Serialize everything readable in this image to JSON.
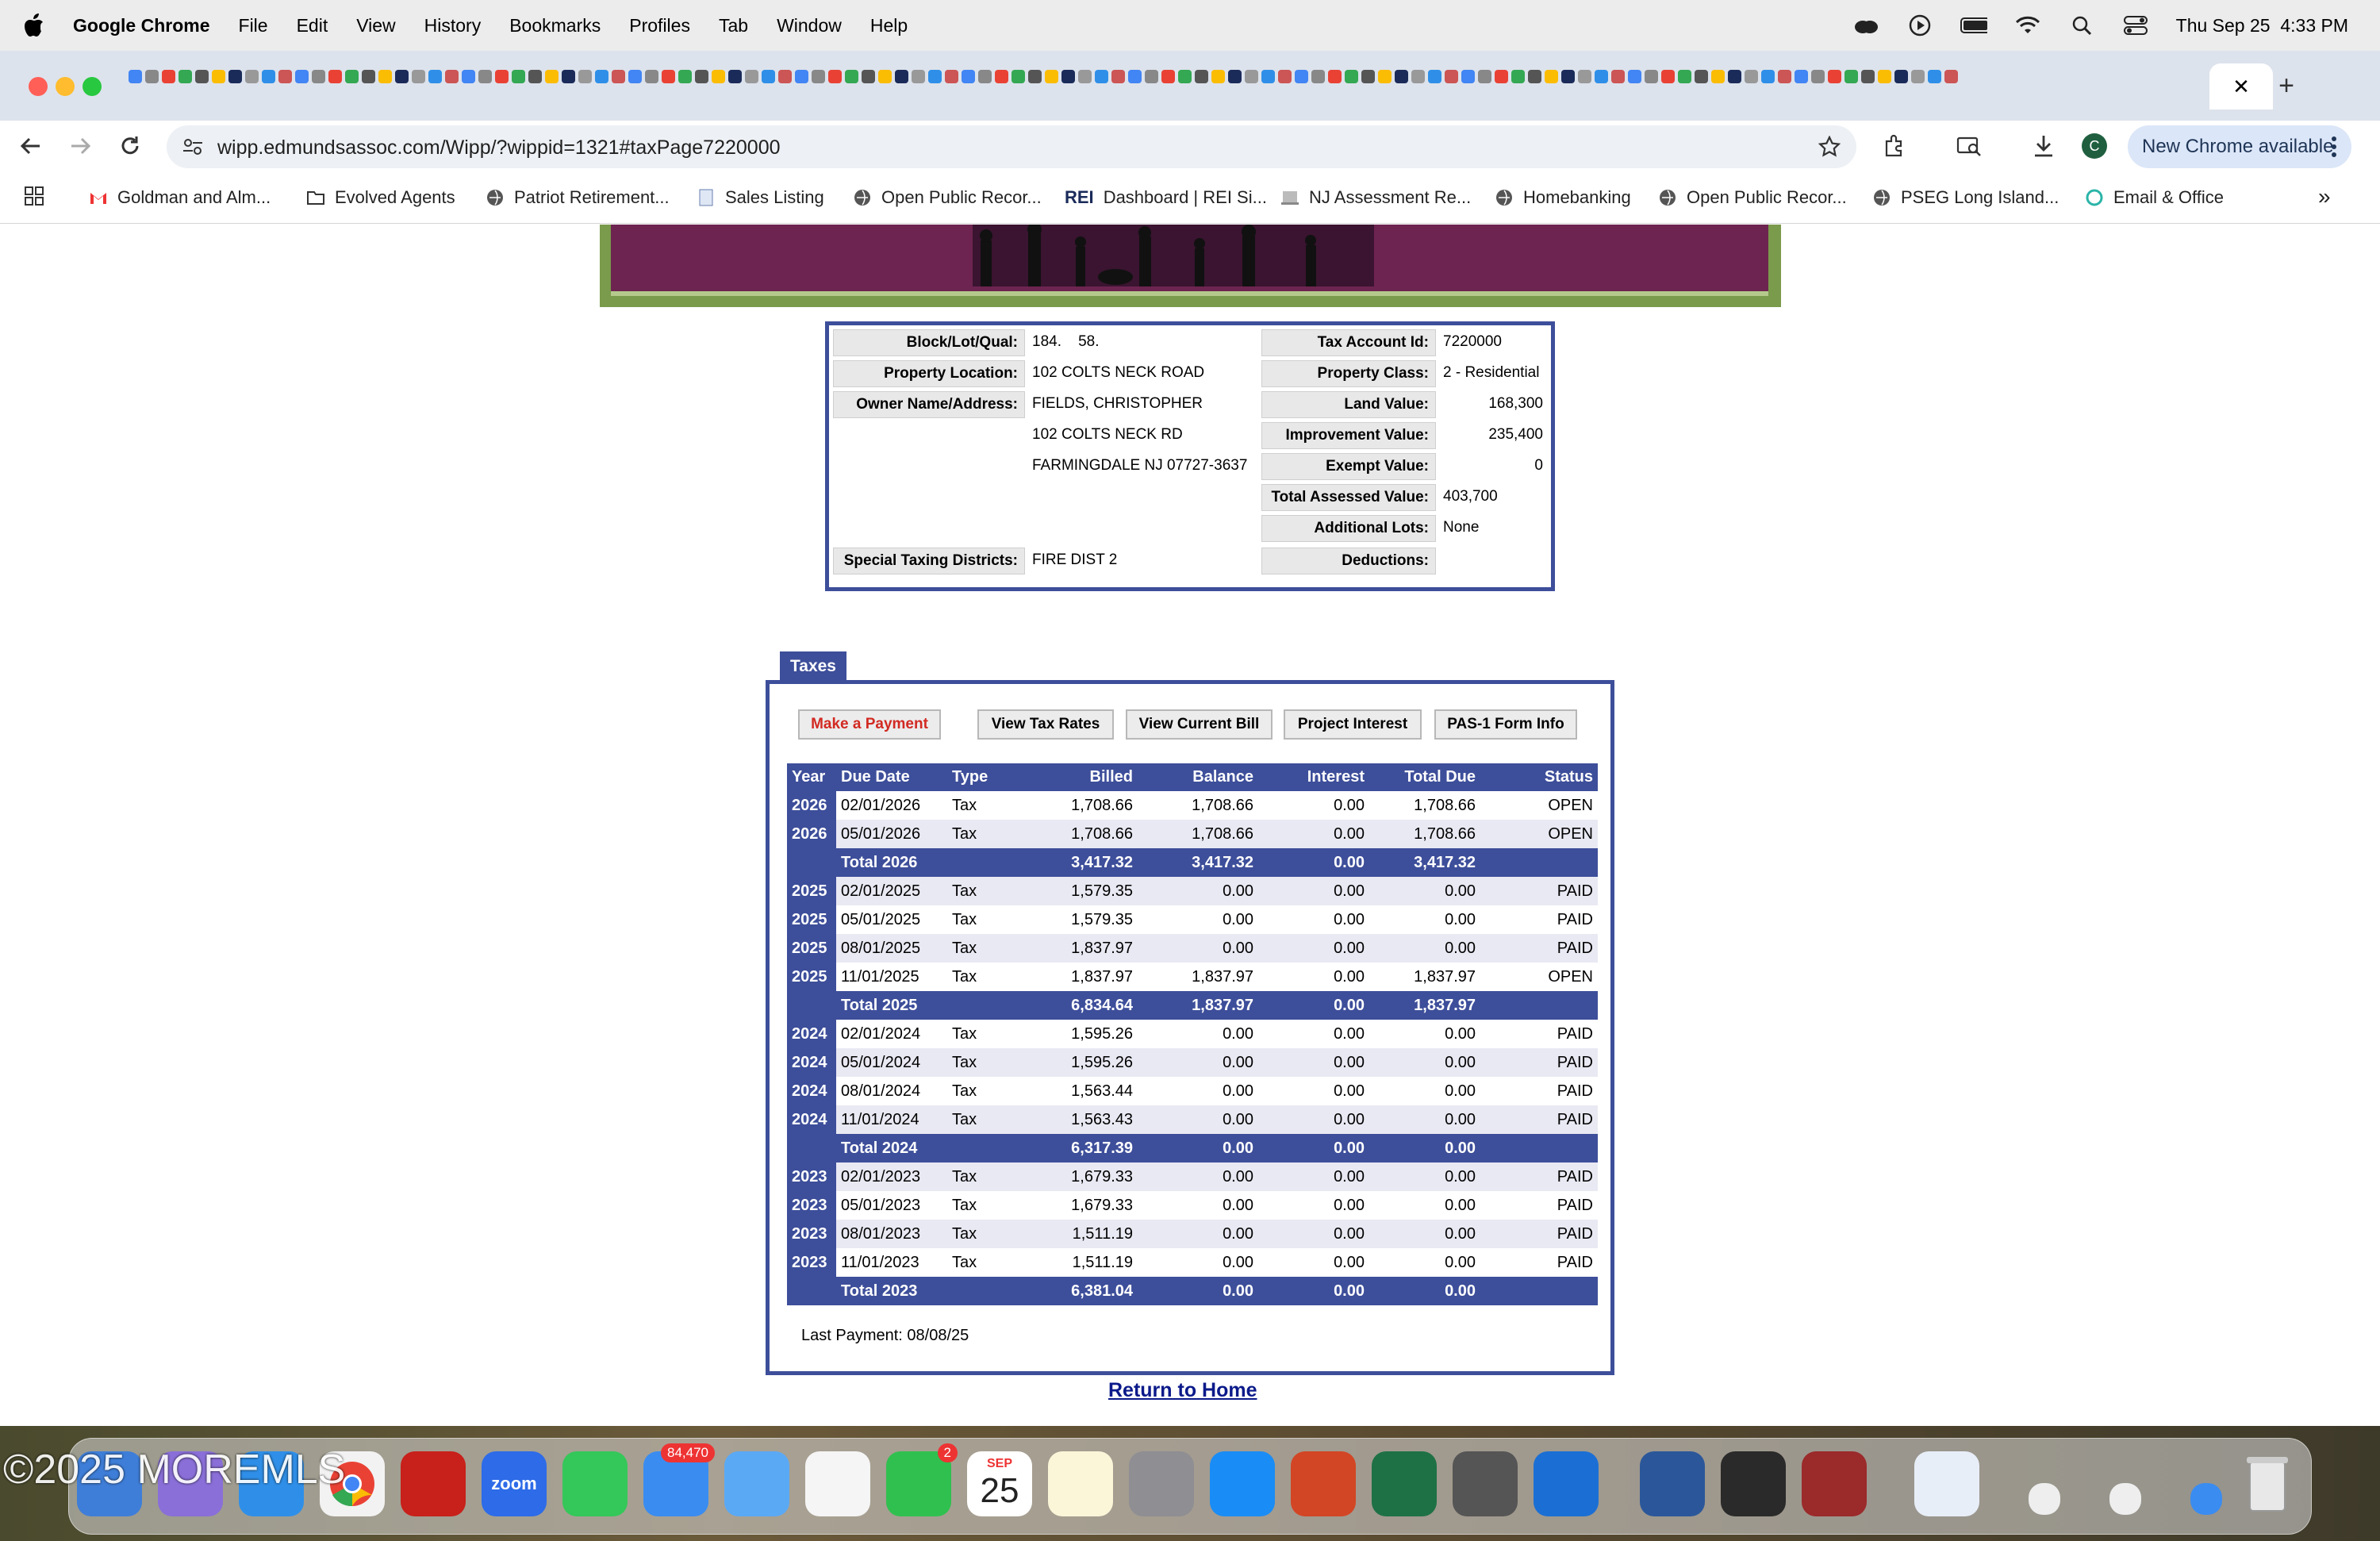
{
  "menubar": {
    "app_name": "Google Chrome",
    "items": [
      "File",
      "Edit",
      "View",
      "History",
      "Bookmarks",
      "Profiles",
      "Tab",
      "Window",
      "Help"
    ],
    "datetime": "Thu Sep 25  4:33 PM"
  },
  "browser": {
    "url": "wipp.edmundsassoc.com/Wipp/?wippid=1321#taxPage7220000",
    "new_chrome_label": "New Chrome available",
    "profile_initial": "C",
    "active_tab_close": "✕",
    "new_tab": "+"
  },
  "bookmarks": [
    {
      "label": "Goldman and Alm...",
      "icon": "gmail-icon"
    },
    {
      "label": "Evolved Agents",
      "icon": "folder-icon"
    },
    {
      "label": "Patriot Retirement...",
      "icon": "globe-icon"
    },
    {
      "label": "Sales Listing",
      "icon": "doc-icon"
    },
    {
      "label": "Open Public Recor...",
      "icon": "globe-icon"
    },
    {
      "label": "Dashboard | REI Si...",
      "icon": "rei-icon",
      "prefix": "REI"
    },
    {
      "label": "NJ Assessment Re...",
      "icon": "doc-icon"
    },
    {
      "label": "Homebanking",
      "icon": "globe-icon"
    },
    {
      "label": "Open Public Recor...",
      "icon": "globe-icon"
    },
    {
      "label": "PSEG Long Island...",
      "icon": "globe-icon"
    },
    {
      "label": "Email & Office",
      "icon": "email-office-icon"
    }
  ],
  "property": {
    "left": [
      {
        "label": "Block/Lot/Qual:",
        "value": "184.    58."
      },
      {
        "label": "Property Location:",
        "value": "102 COLTS NECK ROAD"
      },
      {
        "label": "Owner Name/Address:",
        "value": "FIELDS, CHRISTOPHER"
      },
      {
        "label": "",
        "value": "102 COLTS NECK RD"
      },
      {
        "label": "",
        "value": "FARMINGDALE NJ 07727-3637"
      },
      {
        "label": "Special Taxing Districts:",
        "value": "FIRE DIST 2"
      }
    ],
    "right": [
      {
        "label": "Tax Account Id:",
        "value": "7220000"
      },
      {
        "label": "Property Class:",
        "value": "2 - Residential"
      },
      {
        "label": "Land Value:",
        "value": "168,300"
      },
      {
        "label": "Improvement Value:",
        "value": "235,400"
      },
      {
        "label": "Exempt Value:",
        "value": "0"
      },
      {
        "label": "Total Assessed Value:",
        "value": "403,700"
      },
      {
        "label": "Additional Lots:",
        "value": "None"
      },
      {
        "label": "Deductions:",
        "value": ""
      }
    ]
  },
  "taxes": {
    "tab_label": "Taxes",
    "buttons": {
      "make_payment": "Make a Payment",
      "view_tax_rates": "View Tax Rates",
      "view_current_bill": "View Current Bill",
      "project_interest": "Project Interest",
      "pas1_form": "PAS-1 Form Info"
    },
    "columns": [
      "Year",
      "Due Date",
      "Type",
      "Billed",
      "Balance",
      "Interest",
      "Total Due",
      "Status"
    ],
    "rows": [
      {
        "kind": "row",
        "year": "2026",
        "due": "02/01/2026",
        "type": "Tax",
        "billed": "1,708.66",
        "balance": "1,708.66",
        "interest": "0.00",
        "total": "1,708.66",
        "status": "OPEN"
      },
      {
        "kind": "row",
        "year": "2026",
        "due": "05/01/2026",
        "type": "Tax",
        "billed": "1,708.66",
        "balance": "1,708.66",
        "interest": "0.00",
        "total": "1,708.66",
        "status": "OPEN"
      },
      {
        "kind": "total",
        "label": "Total 2026",
        "billed": "3,417.32",
        "balance": "3,417.32",
        "interest": "0.00",
        "total": "3,417.32"
      },
      {
        "kind": "row",
        "year": "2025",
        "due": "02/01/2025",
        "type": "Tax",
        "billed": "1,579.35",
        "balance": "0.00",
        "interest": "0.00",
        "total": "0.00",
        "status": "PAID"
      },
      {
        "kind": "row",
        "year": "2025",
        "due": "05/01/2025",
        "type": "Tax",
        "billed": "1,579.35",
        "balance": "0.00",
        "interest": "0.00",
        "total": "0.00",
        "status": "PAID"
      },
      {
        "kind": "row",
        "year": "2025",
        "due": "08/01/2025",
        "type": "Tax",
        "billed": "1,837.97",
        "balance": "0.00",
        "interest": "0.00",
        "total": "0.00",
        "status": "PAID"
      },
      {
        "kind": "row",
        "year": "2025",
        "due": "11/01/2025",
        "type": "Tax",
        "billed": "1,837.97",
        "balance": "1,837.97",
        "interest": "0.00",
        "total": "1,837.97",
        "status": "OPEN"
      },
      {
        "kind": "total",
        "label": "Total 2025",
        "billed": "6,834.64",
        "balance": "1,837.97",
        "interest": "0.00",
        "total": "1,837.97"
      },
      {
        "kind": "row",
        "year": "2024",
        "due": "02/01/2024",
        "type": "Tax",
        "billed": "1,595.26",
        "balance": "0.00",
        "interest": "0.00",
        "total": "0.00",
        "status": "PAID"
      },
      {
        "kind": "row",
        "year": "2024",
        "due": "05/01/2024",
        "type": "Tax",
        "billed": "1,595.26",
        "balance": "0.00",
        "interest": "0.00",
        "total": "0.00",
        "status": "PAID"
      },
      {
        "kind": "row",
        "year": "2024",
        "due": "08/01/2024",
        "type": "Tax",
        "billed": "1,563.44",
        "balance": "0.00",
        "interest": "0.00",
        "total": "0.00",
        "status": "PAID"
      },
      {
        "kind": "row",
        "year": "2024",
        "due": "11/01/2024",
        "type": "Tax",
        "billed": "1,563.43",
        "balance": "0.00",
        "interest": "0.00",
        "total": "0.00",
        "status": "PAID"
      },
      {
        "kind": "total",
        "label": "Total 2024",
        "billed": "6,317.39",
        "balance": "0.00",
        "interest": "0.00",
        "total": "0.00"
      },
      {
        "kind": "row",
        "year": "2023",
        "due": "02/01/2023",
        "type": "Tax",
        "billed": "1,679.33",
        "balance": "0.00",
        "interest": "0.00",
        "total": "0.00",
        "status": "PAID"
      },
      {
        "kind": "row",
        "year": "2023",
        "due": "05/01/2023",
        "type": "Tax",
        "billed": "1,679.33",
        "balance": "0.00",
        "interest": "0.00",
        "total": "0.00",
        "status": "PAID"
      },
      {
        "kind": "row",
        "year": "2023",
        "due": "08/01/2023",
        "type": "Tax",
        "billed": "1,511.19",
        "balance": "0.00",
        "interest": "0.00",
        "total": "0.00",
        "status": "PAID"
      },
      {
        "kind": "row",
        "year": "2023",
        "due": "11/01/2023",
        "type": "Tax",
        "billed": "1,511.19",
        "balance": "0.00",
        "interest": "0.00",
        "total": "0.00",
        "status": "PAID"
      },
      {
        "kind": "total",
        "label": "Total 2023",
        "billed": "6,381.04",
        "balance": "0.00",
        "interest": "0.00",
        "total": "0.00"
      }
    ],
    "last_payment": "Last Payment: 08/08/25"
  },
  "return_home": "Return to Home",
  "dock": {
    "mail_badge": "84,470",
    "facetime_badge": "2",
    "calendar_month": "SEP",
    "calendar_day": "25",
    "zoom_label": "zoom"
  },
  "watermark": "©2025 MOREMLS",
  "colors": {
    "accent": "#3d4e9a",
    "pay_button_text": "#d22a22",
    "link": "#0b1a8a"
  }
}
